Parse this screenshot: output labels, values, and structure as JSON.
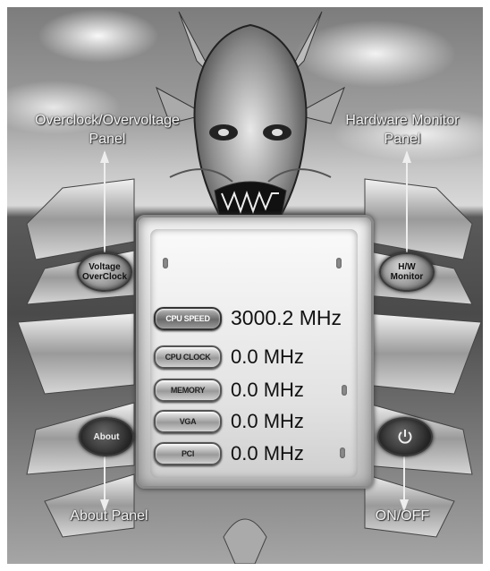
{
  "labels": {
    "overclock_panel": [
      "Overclock/Overvoltage",
      "Panel"
    ],
    "hw_monitor_panel": [
      "Hardware Monitor",
      "Panel"
    ],
    "about_panel": "About Panel",
    "onoff": "ON/OFF"
  },
  "buttons": {
    "voltage_overclock": [
      "Voltage",
      "OverClock"
    ],
    "hw_monitor": [
      "H/W",
      "Monitor"
    ],
    "about": "About",
    "power_icon": "power-icon"
  },
  "readings": [
    {
      "label": "CPU SPEED",
      "value": "3000.2 MHz"
    },
    {
      "label": "CPU CLOCK",
      "value": "0.0 MHz"
    },
    {
      "label": "MEMORY",
      "value": "0.0 MHz"
    },
    {
      "label": "VGA",
      "value": "0.0 MHz"
    },
    {
      "label": "PCI",
      "value": "0.0 MHz"
    }
  ]
}
